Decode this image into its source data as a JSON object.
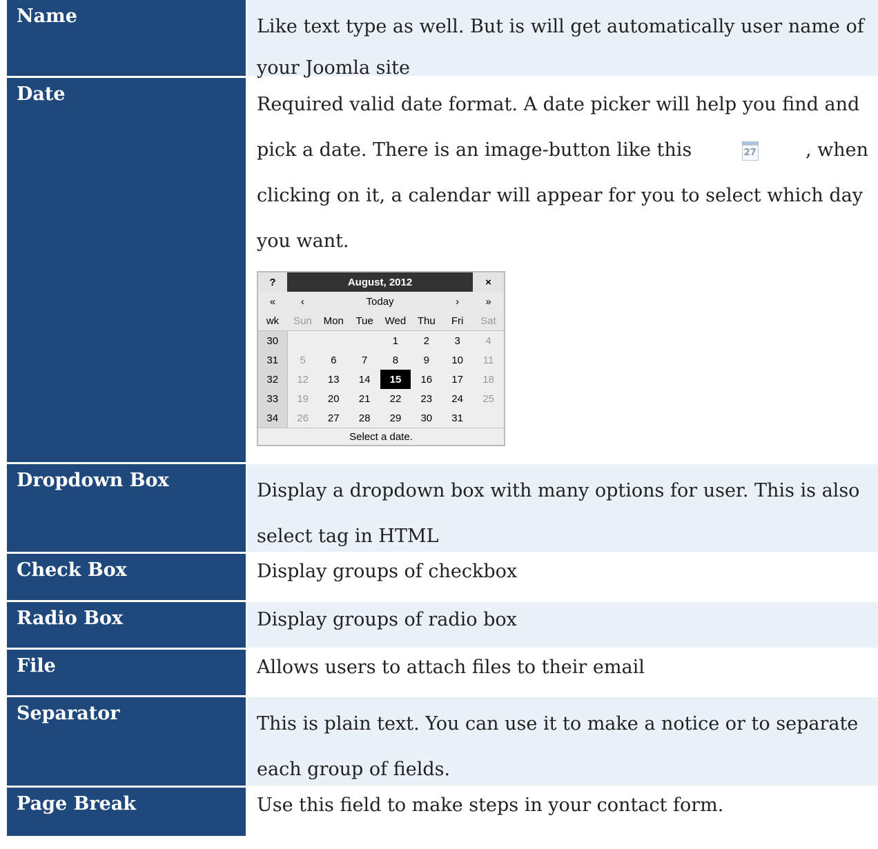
{
  "rows": [
    {
      "name": "Name",
      "lines": [
        "Like text type as well. But is will get automatically user name of",
        "your Joomla site"
      ]
    },
    {
      "name": "Date",
      "lines": [
        "Required valid date format. A date picker will help you find and",
        "pick a date. There is an image-button like this",
        ", when",
        "clicking on it, a calendar will appear for you to select which day",
        "you want."
      ],
      "calendar_icon_label": "27"
    },
    {
      "name": "Dropdown Box",
      "lines": [
        "Display a dropdown box with many options for user. This is also",
        "select tag in HTML"
      ]
    },
    {
      "name": "Check Box",
      "lines": [
        "Display groups of checkbox"
      ]
    },
    {
      "name": "Radio Box",
      "lines": [
        "Display groups of radio box"
      ]
    },
    {
      "name": "File",
      "lines": [
        "Allows users to attach files to their email"
      ]
    },
    {
      "name": "Separator",
      "lines": [
        "This is plain text. You can use it to make a notice or to separate",
        "each group of fields."
      ]
    },
    {
      "name": "Page Break",
      "lines": [
        "Use this field to make steps in your contact form."
      ]
    }
  ],
  "datepicker": {
    "help": "?",
    "title": "August, 2012",
    "close": "×",
    "nav": [
      "«",
      "‹",
      "Today",
      "›",
      "»"
    ],
    "days": [
      "wk",
      "Sun",
      "Mon",
      "Tue",
      "Wed",
      "Thu",
      "Fri",
      "Sat"
    ],
    "weeks": [
      [
        "30",
        "",
        "",
        "",
        "1",
        "2",
        "3",
        "4"
      ],
      [
        "31",
        "5",
        "6",
        "7",
        "8",
        "9",
        "10",
        "11"
      ],
      [
        "32",
        "12",
        "13",
        "14",
        "15",
        "16",
        "17",
        "18"
      ],
      [
        "33",
        "19",
        "20",
        "21",
        "22",
        "23",
        "24",
        "25"
      ],
      [
        "34",
        "26",
        "27",
        "28",
        "29",
        "30",
        "31",
        ""
      ]
    ],
    "selected": "15",
    "footer": "Select a date."
  }
}
